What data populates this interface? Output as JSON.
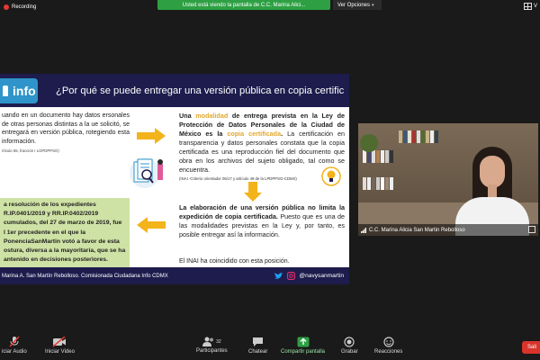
{
  "top": {
    "recording": "Recording",
    "share_banner": "Usted está viendo la pantalla de C.C. Marina Alici...",
    "view_options": "Ver Opciones",
    "view_label": "V"
  },
  "slide": {
    "logo": "info",
    "title": "¿Por qué se puede entregar una versión pública en copia certificada?",
    "left_text": "uando en un documento hay datos ersonales de otras personas distintas a la ue solicitó, se entregará en versión pública, rotegiendo esta información.",
    "left_note": "rtículo 55, fracción I LGPDPPSO)",
    "green_lines": [
      "a resolución de los expedientes",
      "R.IP.0401/2019     y     RR.IP.0402/2019",
      "cumulados, del 27 de marzo de 2019, fue",
      "l    1er    precedente    en    el    que    la",
      "PonenciaSanMartin votó a favor de esta",
      "ostura, diversa a la mayoritaria, que se ha",
      "antenido en decisiones posteriores."
    ],
    "right1_pre": "Una",
    "right1_hl1": "modalidad",
    "right1_mid": "de entrega prevista en la Ley de Protección de Datos Personales de la Ciudad de México es la",
    "right1_hl2": "copia certificada",
    "right1_end": ".",
    "right1_body": "La certificación en transparencia y datos personales constata que la copia certificada es una reproducción fiel del documento que obra en los archivos del sujeto obligado, tal como se encuentra.",
    "right1_crit": "(INAI -Criterio orientador 06/17 y artículo 49 de la LPDPPSO-CDMX)",
    "right2_bold": "La elaboración de una versión pública no limita la expedición de copia certificada.",
    "right2_body": "Puesto que es una de las modalidades previstas en la Ley y, por tanto, es posible entregar así la información.",
    "final": "El INAI ha coincidido con esta posición.",
    "footer": "Marina A. San Martín Rebolloso. Comisionada Ciudadana Info CDMX",
    "handle": "@navysanmartin"
  },
  "video": {
    "name": "C.C. Marina Alicia San Martin Rebolloso"
  },
  "toolbar": {
    "audio": "iciar Audio",
    "video": "Iniciar Video",
    "participants": "Participantes",
    "participants_count": "32",
    "chat": "Chatear",
    "share": "Compartir pantalla",
    "record": "Grabar",
    "reactions": "Reacciones",
    "leave": "Sali"
  },
  "colors": {
    "slide_navy": "#1d1c4d",
    "accent_blue": "#2f94c9",
    "highlight_gold": "#e2a82d",
    "green_box": "#cfe2a5",
    "share_green": "#2ea043",
    "leave_red": "#d9342b"
  }
}
